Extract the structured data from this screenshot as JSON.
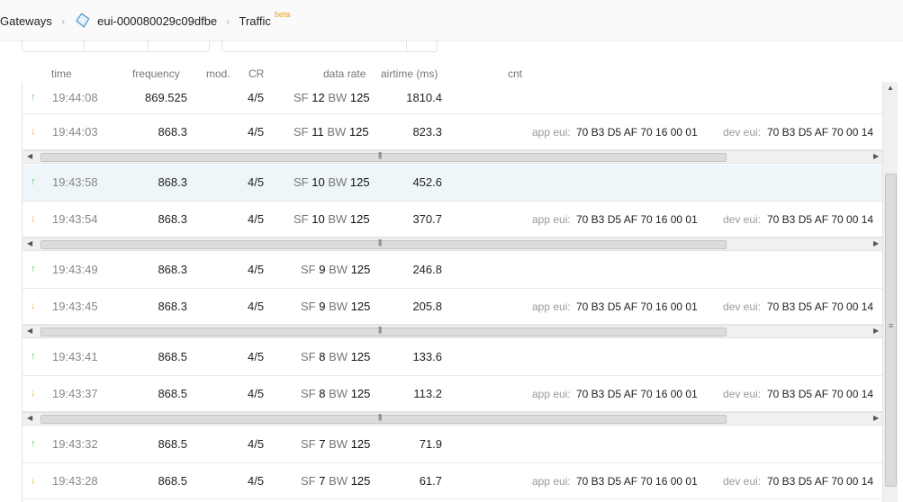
{
  "breadcrumb": {
    "gateways": "Gateways",
    "gateway_id": "eui-000080029c09dfbe",
    "traffic": "Traffic",
    "beta": "beta"
  },
  "columns": {
    "time": "time",
    "frequency": "frequency",
    "mod": "mod.",
    "cr": "CR",
    "data_rate": "data rate",
    "airtime": "airtime (ms)",
    "cnt": "cnt"
  },
  "labels": {
    "app_eui": "app eui:",
    "dev_eui": "dev eui:",
    "sf": "SF",
    "bw": "BW"
  },
  "icons": {
    "uplink": "up-arrow-icon",
    "downlink": "down-arrow-icon",
    "gateway": "gateway-icon"
  },
  "colors": {
    "uplink": "#5cc85c",
    "downlink": "#f0b040",
    "beta": "#f0a020",
    "highlight_row": "#eef6f9"
  },
  "rows": [
    {
      "direction": "up",
      "time": "19:44:08",
      "frequency": "869.525",
      "cr": "4/5",
      "sf": "12",
      "bw": "125",
      "airtime": "1810.4"
    },
    {
      "direction": "down",
      "time": "19:44:03",
      "frequency": "868.3",
      "cr": "4/5",
      "sf": "11",
      "bw": "125",
      "airtime": "823.3",
      "app_eui": "70 B3 D5 AF 70 16 00 01",
      "dev_eui": "70 B3 D5 AF 70 00 14"
    },
    {
      "direction": "up",
      "time": "19:43:58",
      "frequency": "868.3",
      "cr": "4/5",
      "sf": "10",
      "bw": "125",
      "airtime": "452.6"
    },
    {
      "direction": "down",
      "time": "19:43:54",
      "frequency": "868.3",
      "cr": "4/5",
      "sf": "10",
      "bw": "125",
      "airtime": "370.7",
      "app_eui": "70 B3 D5 AF 70 16 00 01",
      "dev_eui": "70 B3 D5 AF 70 00 14"
    },
    {
      "direction": "up",
      "time": "19:43:49",
      "frequency": "868.3",
      "cr": "4/5",
      "sf": "9",
      "bw": "125",
      "airtime": "246.8"
    },
    {
      "direction": "down",
      "time": "19:43:45",
      "frequency": "868.3",
      "cr": "4/5",
      "sf": "9",
      "bw": "125",
      "airtime": "205.8",
      "app_eui": "70 B3 D5 AF 70 16 00 01",
      "dev_eui": "70 B3 D5 AF 70 00 14"
    },
    {
      "direction": "up",
      "time": "19:43:41",
      "frequency": "868.5",
      "cr": "4/5",
      "sf": "8",
      "bw": "125",
      "airtime": "133.6"
    },
    {
      "direction": "down",
      "time": "19:43:37",
      "frequency": "868.5",
      "cr": "4/5",
      "sf": "8",
      "bw": "125",
      "airtime": "113.2",
      "app_eui": "70 B3 D5 AF 70 16 00 01",
      "dev_eui": "70 B3 D5 AF 70 00 14"
    },
    {
      "direction": "up",
      "time": "19:43:32",
      "frequency": "868.5",
      "cr": "4/5",
      "sf": "7",
      "bw": "125",
      "airtime": "71.9"
    },
    {
      "direction": "down",
      "time": "19:43:28",
      "frequency": "868.5",
      "cr": "4/5",
      "sf": "7",
      "bw": "125",
      "airtime": "61.7",
      "app_eui": "70 B3 D5 AF 70 16 00 01",
      "dev_eui": "70 B3 D5 AF 70 00 14"
    }
  ]
}
